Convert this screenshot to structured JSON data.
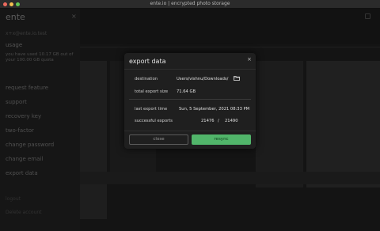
{
  "window": {
    "title": "ente.io | encrypted photo storage"
  },
  "sidebar": {
    "brand": "ente",
    "close_glyph": "×",
    "email": "x+x@ente.io.test",
    "usage_heading": "usage",
    "usage_text": "you have used 10.17 GB out of your 100.00 GB quota",
    "items": [
      {
        "label": "request feature"
      },
      {
        "label": "support"
      },
      {
        "label": "recovery key"
      },
      {
        "label": "two-factor"
      },
      {
        "label": "change password"
      },
      {
        "label": "change email"
      },
      {
        "label": "export data"
      }
    ],
    "bottom1": "logout",
    "bottom2": "Delete account"
  },
  "modal": {
    "title": "export data",
    "close_glyph": "×",
    "destination_label": "destination",
    "destination_value": "Users/vishnu/Downloads/",
    "size_label": "total export size",
    "size_value": "71.64 GB",
    "last_time_label": "last export time",
    "last_time_value": "Sun, 5 September, 2021 08:33 PM",
    "success_label": "successful exports",
    "success_done": "21476",
    "success_sep": "/",
    "success_total": "21490",
    "close_button": "close",
    "resync_button": "resync"
  },
  "colors": {
    "accent": "#51b56a",
    "modal_bg": "#1f1f1f",
    "backdrop": "#0b0b0b"
  }
}
